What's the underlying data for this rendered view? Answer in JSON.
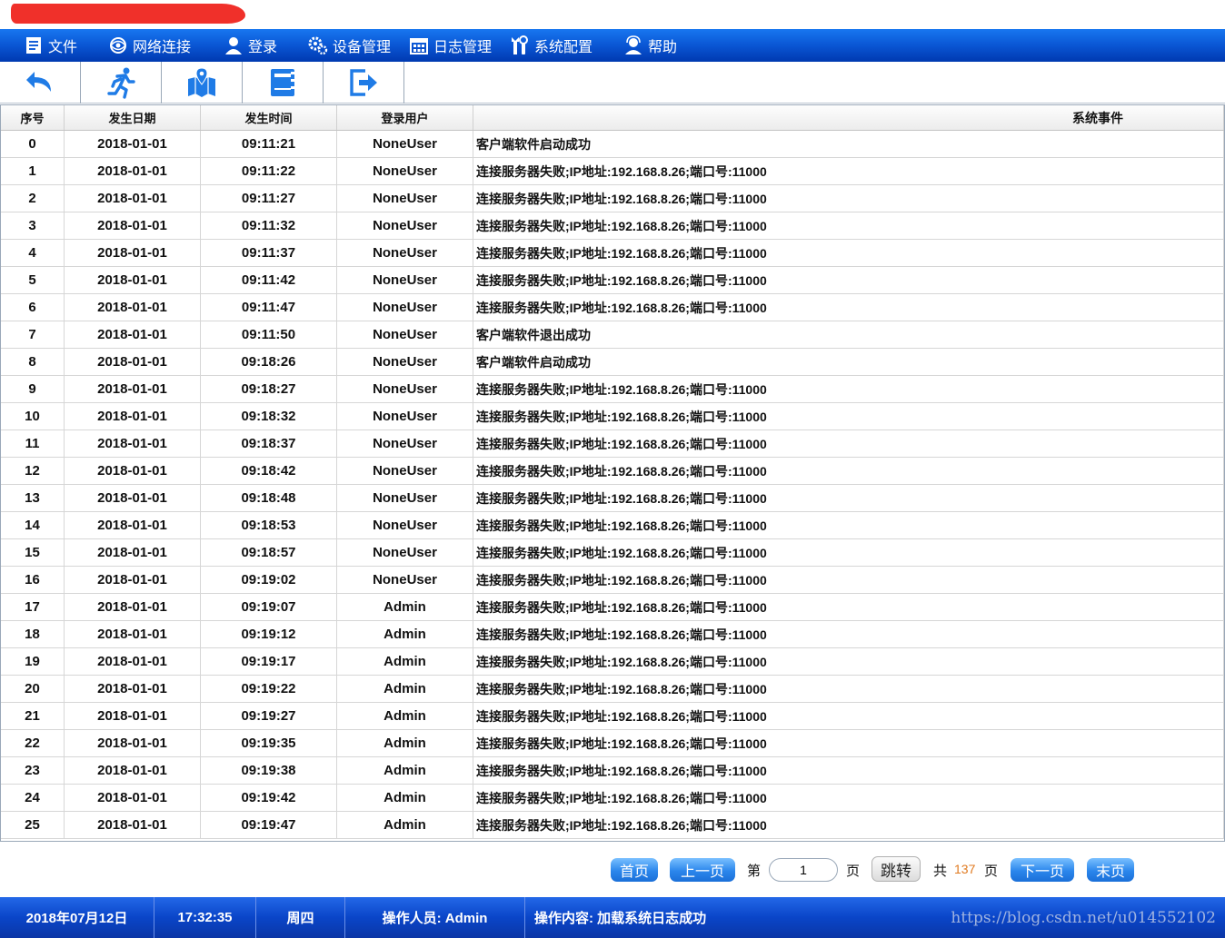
{
  "menu": [
    {
      "label": "文件",
      "icon": "document-icon"
    },
    {
      "label": "网络连接",
      "icon": "network-icon"
    },
    {
      "label": "登录",
      "icon": "user-icon"
    },
    {
      "label": "设备管理",
      "icon": "gears-icon"
    },
    {
      "label": "日志管理",
      "icon": "calendar-icon"
    },
    {
      "label": "系统配置",
      "icon": "wrench-icon"
    },
    {
      "label": "帮助",
      "icon": "support-icon"
    }
  ],
  "toolbar": [
    "back-arrow-icon",
    "running-man-icon",
    "map-pin-icon",
    "notebook-icon",
    "logout-icon"
  ],
  "table": {
    "headers": {
      "idx": "序号",
      "date": "发生日期",
      "time": "发生时间",
      "user": "登录用户",
      "event": "系统事件"
    },
    "rows": [
      [
        "0",
        "2018-01-01",
        "09:11:21",
        "NoneUser",
        "客户端软件启动成功"
      ],
      [
        "1",
        "2018-01-01",
        "09:11:22",
        "NoneUser",
        "连接服务器失败;IP地址:192.168.8.26;端口号:11000"
      ],
      [
        "2",
        "2018-01-01",
        "09:11:27",
        "NoneUser",
        "连接服务器失败;IP地址:192.168.8.26;端口号:11000"
      ],
      [
        "3",
        "2018-01-01",
        "09:11:32",
        "NoneUser",
        "连接服务器失败;IP地址:192.168.8.26;端口号:11000"
      ],
      [
        "4",
        "2018-01-01",
        "09:11:37",
        "NoneUser",
        "连接服务器失败;IP地址:192.168.8.26;端口号:11000"
      ],
      [
        "5",
        "2018-01-01",
        "09:11:42",
        "NoneUser",
        "连接服务器失败;IP地址:192.168.8.26;端口号:11000"
      ],
      [
        "6",
        "2018-01-01",
        "09:11:47",
        "NoneUser",
        "连接服务器失败;IP地址:192.168.8.26;端口号:11000"
      ],
      [
        "7",
        "2018-01-01",
        "09:11:50",
        "NoneUser",
        "客户端软件退出成功"
      ],
      [
        "8",
        "2018-01-01",
        "09:18:26",
        "NoneUser",
        "客户端软件启动成功"
      ],
      [
        "9",
        "2018-01-01",
        "09:18:27",
        "NoneUser",
        "连接服务器失败;IP地址:192.168.8.26;端口号:11000"
      ],
      [
        "10",
        "2018-01-01",
        "09:18:32",
        "NoneUser",
        "连接服务器失败;IP地址:192.168.8.26;端口号:11000"
      ],
      [
        "11",
        "2018-01-01",
        "09:18:37",
        "NoneUser",
        "连接服务器失败;IP地址:192.168.8.26;端口号:11000"
      ],
      [
        "12",
        "2018-01-01",
        "09:18:42",
        "NoneUser",
        "连接服务器失败;IP地址:192.168.8.26;端口号:11000"
      ],
      [
        "13",
        "2018-01-01",
        "09:18:48",
        "NoneUser",
        "连接服务器失败;IP地址:192.168.8.26;端口号:11000"
      ],
      [
        "14",
        "2018-01-01",
        "09:18:53",
        "NoneUser",
        "连接服务器失败;IP地址:192.168.8.26;端口号:11000"
      ],
      [
        "15",
        "2018-01-01",
        "09:18:57",
        "NoneUser",
        "连接服务器失败;IP地址:192.168.8.26;端口号:11000"
      ],
      [
        "16",
        "2018-01-01",
        "09:19:02",
        "NoneUser",
        "连接服务器失败;IP地址:192.168.8.26;端口号:11000"
      ],
      [
        "17",
        "2018-01-01",
        "09:19:07",
        "Admin",
        "连接服务器失败;IP地址:192.168.8.26;端口号:11000"
      ],
      [
        "18",
        "2018-01-01",
        "09:19:12",
        "Admin",
        "连接服务器失败;IP地址:192.168.8.26;端口号:11000"
      ],
      [
        "19",
        "2018-01-01",
        "09:19:17",
        "Admin",
        "连接服务器失败;IP地址:192.168.8.26;端口号:11000"
      ],
      [
        "20",
        "2018-01-01",
        "09:19:22",
        "Admin",
        "连接服务器失败;IP地址:192.168.8.26;端口号:11000"
      ],
      [
        "21",
        "2018-01-01",
        "09:19:27",
        "Admin",
        "连接服务器失败;IP地址:192.168.8.26;端口号:11000"
      ],
      [
        "22",
        "2018-01-01",
        "09:19:35",
        "Admin",
        "连接服务器失败;IP地址:192.168.8.26;端口号:11000"
      ],
      [
        "23",
        "2018-01-01",
        "09:19:38",
        "Admin",
        "连接服务器失败;IP地址:192.168.8.26;端口号:11000"
      ],
      [
        "24",
        "2018-01-01",
        "09:19:42",
        "Admin",
        "连接服务器失败;IP地址:192.168.8.26;端口号:11000"
      ],
      [
        "25",
        "2018-01-01",
        "09:19:47",
        "Admin",
        "连接服务器失败;IP地址:192.168.8.26;端口号:11000"
      ]
    ]
  },
  "pager": {
    "first": "首页",
    "prev": "上一页",
    "page_prefix": "第",
    "page_value": "1",
    "page_suffix": "页",
    "jump": "跳转",
    "total_prefix": "共",
    "total": "137",
    "total_suffix": "页",
    "next": "下一页",
    "last": "末页"
  },
  "status": {
    "date": "2018年07月12日",
    "time": "17:32:35",
    "weekday": "周四",
    "operator": "操作人员: Admin",
    "action": "操作内容: 加载系统日志成功",
    "watermark": "https://blog.csdn.net/u014552102"
  },
  "colors": {
    "menubar": "#0a56d4",
    "statusbar": "#0a45c8",
    "pager_button": "#2b86ec",
    "total_pages": "#e07a20"
  }
}
